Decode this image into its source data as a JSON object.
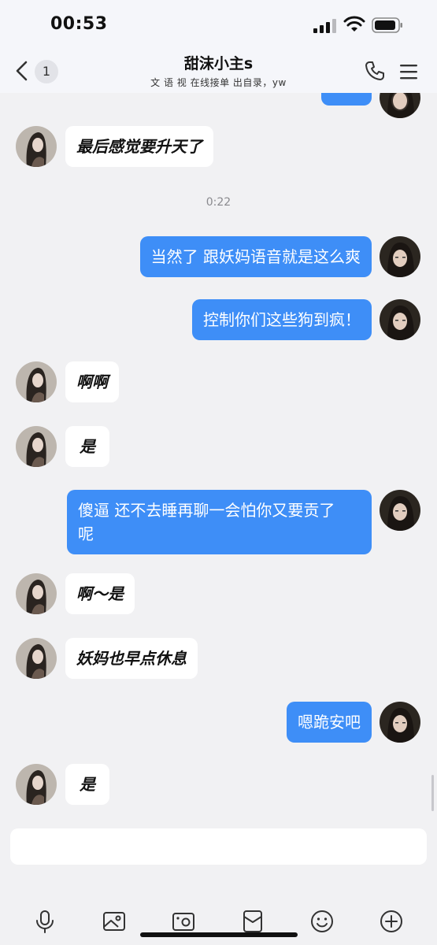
{
  "status": {
    "time": "00:53"
  },
  "header": {
    "back_count": "1",
    "title": "甜沫小主s",
    "subtitle": "文 语 视 在线接单 出自录，yw"
  },
  "messages": [
    {
      "side": "in",
      "text": "最后感觉要升天了"
    },
    {
      "type": "time",
      "text": "0:22"
    },
    {
      "side": "out",
      "text": "当然了 跟妖妈语音就是这么爽"
    },
    {
      "side": "out",
      "text": "控制你们这些狗到疯！"
    },
    {
      "side": "in",
      "text": "啊啊"
    },
    {
      "side": "in",
      "text": "是"
    },
    {
      "side": "out",
      "text_line1": "傻逼 还不去睡再聊一会怕你又要贡了",
      "text_line2": "呢"
    },
    {
      "side": "in",
      "text": "啊～是"
    },
    {
      "side": "in",
      "text": "妖妈也早点休息"
    },
    {
      "side": "out",
      "text": "嗯跪安吧"
    },
    {
      "side": "in",
      "text": "是"
    }
  ],
  "toolbar": [
    "microphone-icon",
    "image-icon",
    "camera-icon",
    "red-packet-icon",
    "emoji-icon",
    "plus-icon"
  ],
  "colors": {
    "outgoing": "#3e8ef7",
    "incoming": "#ffffff",
    "background": "#f1f1f3"
  }
}
